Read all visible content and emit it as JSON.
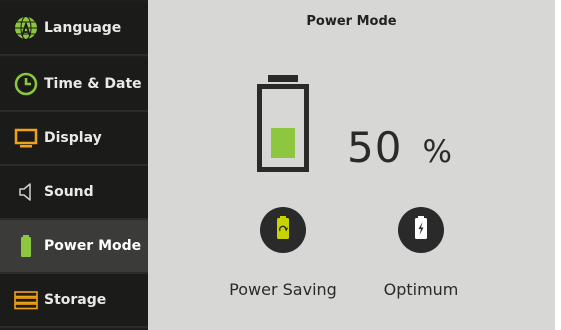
{
  "sidebar": {
    "items": [
      {
        "label": "Language",
        "icon": "globe-icon"
      },
      {
        "label": "Time & Date",
        "icon": "clock-icon"
      },
      {
        "label": "Display",
        "icon": "monitor-icon"
      },
      {
        "label": "Sound",
        "icon": "speaker-icon"
      },
      {
        "label": "Power Mode",
        "icon": "battery-icon"
      },
      {
        "label": "Storage",
        "icon": "storage-icon"
      }
    ],
    "active_index": 4
  },
  "main": {
    "title": "Power Mode",
    "battery_level": 0.5,
    "battery_value": "50",
    "battery_unit": "%",
    "modes": [
      {
        "label": "Power Saving",
        "icon": "recycle-battery-icon"
      },
      {
        "label": "Optimum",
        "icon": "bolt-battery-icon"
      }
    ]
  },
  "colors": {
    "accent_green": "#8dc63f",
    "sidebar_bg": "#1b1b19",
    "sidebar_active_bg": "#3b3b39",
    "main_bg": "#d7d7d6",
    "icon_dark": "#2a2a2a"
  }
}
